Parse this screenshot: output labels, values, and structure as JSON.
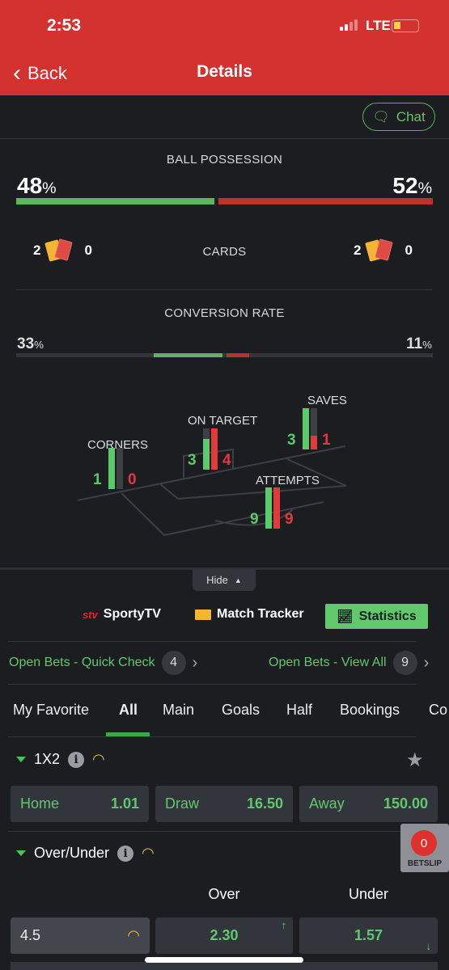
{
  "status_bar": {
    "time": "2:53",
    "network": "LTE",
    "battery_level": 0.25
  },
  "header": {
    "back_label": "Back",
    "title": "Details"
  },
  "chat_label": "Chat",
  "possession": {
    "label": "BALL POSSESSION",
    "home": 48,
    "away": 52,
    "unit": "%"
  },
  "cards": {
    "label": "CARDS",
    "home_yellow": "2",
    "home_red": "0",
    "away_yellow": "2",
    "away_red": "0"
  },
  "conversion": {
    "label": "CONVERSION RATE",
    "home": 33,
    "away": 11,
    "unit": "%"
  },
  "pitch_stats": {
    "corners": {
      "label": "CORNERS",
      "home": 1,
      "away": 0
    },
    "on_target": {
      "label": "ON TARGET",
      "home": 3,
      "away": 4
    },
    "saves": {
      "label": "SAVES",
      "home": 3,
      "away": 1
    },
    "attempts": {
      "label": "ATTEMPTS",
      "home": 9,
      "away": 9
    }
  },
  "hide_label": "Hide",
  "media_tabs": {
    "sportytv": "SportyTV",
    "match_tracker": "Match Tracker",
    "statistics": "Statistics"
  },
  "open_bets": {
    "quick_check": "Open Bets - Quick Check",
    "quick_count": "4",
    "view_all": "Open Bets - View All",
    "view_count": "9"
  },
  "market_tabs": [
    "My Favorite",
    "All",
    "Main",
    "Goals",
    "Half",
    "Bookings",
    "Co"
  ],
  "active_market_tab": "All",
  "market_1x2": {
    "title": "1X2",
    "home_label": "Home",
    "home_odds": "1.01",
    "draw_label": "Draw",
    "draw_odds": "16.50",
    "away_label": "Away",
    "away_odds": "150.00"
  },
  "over_under": {
    "title": "Over/Under",
    "col_over": "Over",
    "col_under": "Under",
    "rows": [
      {
        "line": "4.5",
        "over": "2.30",
        "under": "1.57",
        "over_trend": "up",
        "under_trend": "down"
      }
    ]
  },
  "betslip": {
    "count": "0",
    "label": "BETSLIP"
  },
  "colors": {
    "header": "#d4322f",
    "home": "#5cc96a",
    "away": "#e03a3a",
    "background": "#1c1d21"
  }
}
